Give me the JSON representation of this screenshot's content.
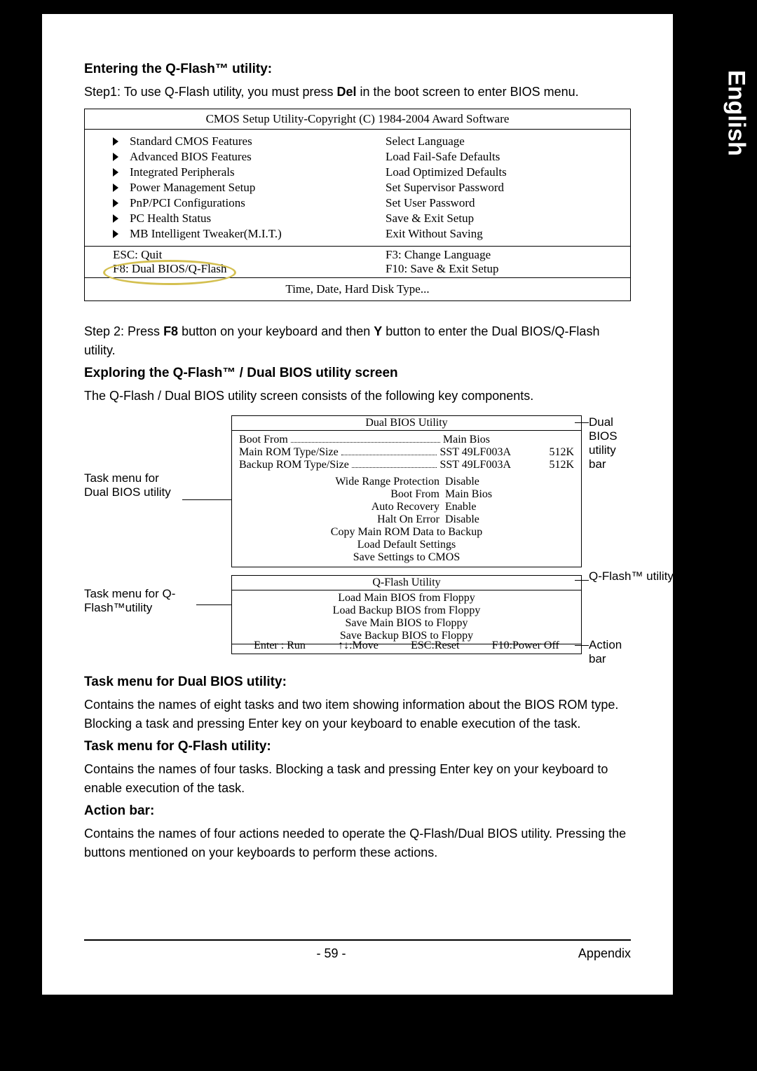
{
  "sideTab": "English",
  "section1": {
    "heading": "Entering the Q-Flash™ utility:",
    "step1_a": "Step1: To use Q-Flash utility, you must press ",
    "step1_bold": "Del",
    "step1_b": " in the boot screen to enter BIOS menu."
  },
  "bios": {
    "title": "CMOS Setup Utility-Copyright (C) 1984-2004 Award Software",
    "left": [
      "Standard CMOS Features",
      "Advanced BIOS Features",
      "Integrated Peripherals",
      "Power Management Setup",
      "PnP/PCI Configurations",
      "PC Health Status",
      "MB Intelligent Tweaker(M.I.T.)"
    ],
    "right": [
      "Select Language",
      "Load Fail-Safe Defaults",
      "Load Optimized Defaults",
      "Set Supervisor Password",
      "Set User Password",
      "Save & Exit Setup",
      "Exit Without Saving"
    ],
    "foot": {
      "esc": "ESC: Quit",
      "f8": "F8: Dual BIOS/Q-Flash",
      "f3": "F3: Change Language",
      "f10": "F10: Save & Exit Setup"
    },
    "bottom": "Time, Date, Hard Disk Type..."
  },
  "step2_a": "Step 2: Press ",
  "step2_b1": "F8",
  "step2_c": " button on your keyboard and then ",
  "step2_b2": "Y",
  "step2_d": " button to enter the Dual BIOS/Q-Flash utility.",
  "section2": {
    "heading": "Exploring the Q-Flash™ / Dual BIOS utility screen",
    "intro": "The Q-Flash / Dual BIOS utility screen consists of the following key components."
  },
  "diagram": {
    "leftLabel1": "Task menu for Dual BIOS utility",
    "leftLabel2": "Task menu for Q-Flash™utility",
    "rightLabel1": "Dual BIOS utility bar",
    "rightLabel2": "Q-Flash™ utility title bar",
    "rightLabel3": "Action bar",
    "dualTitle": "Dual BIOS Utility",
    "bootFromLabel": "Boot From",
    "bootFromVal": "Main Bios",
    "mainRomLabel": "Main ROM Type/Size",
    "mainRomVal": "SST 49LF003A",
    "mainRomSize": "512K",
    "backupRomLabel": "Backup ROM Type/Size",
    "backupRomVal": "SST 49LF003A",
    "backupRomSize": "512K",
    "settings": [
      [
        "Wide Range Protection",
        "Disable"
      ],
      [
        "Boot From",
        "Main Bios"
      ],
      [
        "Auto Recovery",
        "Enable"
      ],
      [
        "Halt On Error",
        "Disable"
      ]
    ],
    "cmds": [
      "Copy Main ROM Data to Backup",
      "Load Default Settings",
      "Save Settings to CMOS"
    ],
    "qTitle": "Q-Flash Utility",
    "qItems": [
      "Load Main BIOS from Floppy",
      "Load Backup BIOS from Floppy",
      "Save Main BIOS to Floppy",
      "Save Backup BIOS to Floppy"
    ],
    "actions": [
      "Enter : Run",
      "↑↓:Move",
      "ESC:Reset",
      "F10:Power Off"
    ]
  },
  "descriptions": {
    "h1": "Task menu for Dual BIOS utility:",
    "p1": "Contains the names of eight tasks and two item showing information about the BIOS ROM type. Blocking a task and pressing Enter key on your keyboard to enable execution of the task.",
    "h2": "Task menu for Q-Flash utility:",
    "p2": "Contains the names of four tasks. Blocking a task and pressing Enter key on your keyboard to enable execution of the task.",
    "h3": "Action bar:",
    "p3": "Contains the names of four actions needed to operate the Q-Flash/Dual BIOS utility. Pressing the buttons mentioned on your keyboards to perform these actions."
  },
  "footer": {
    "page": "- 59 -",
    "section": "Appendix"
  }
}
